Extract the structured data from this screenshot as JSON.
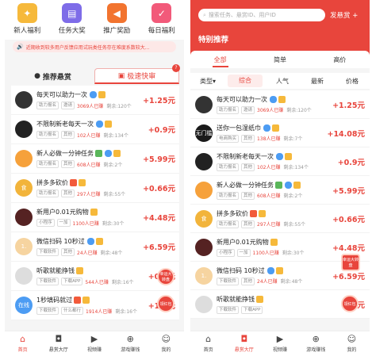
{
  "left": {
    "quick": [
      {
        "label": "新人福利",
        "color": "#f6b93b",
        "icon": "gift-icon",
        "glyph": "✦"
      },
      {
        "label": "任务大奖",
        "color": "#7e6ce8",
        "icon": "clipboard-icon",
        "glyph": "▤"
      },
      {
        "label": "推广奖励",
        "color": "#f2742f",
        "icon": "megaphone-icon",
        "glyph": "◀"
      },
      {
        "label": "每日福利",
        "color": "#f25a7a",
        "icon": "calendar-icon",
        "glyph": "✓"
      }
    ],
    "notice": "近期收到较多用户反馈应用试玩类任务存在难度系数较大...",
    "tabs": {
      "recommend": "推荐悬赏",
      "fast": "极速快审",
      "badge": "?"
    },
    "rows": [
      {
        "title": "每天可以助力一次",
        "tags": [
          "助力报名",
          "邀请"
        ],
        "done": "3069人已赚",
        "left": "剩余:120个",
        "price": "+1.25元",
        "av": "#333",
        "avtext": "",
        "marks": [
          "v",
          "g"
        ]
      },
      {
        "title": "不限制新老每天一次",
        "tags": [
          "助力报名",
          "其他"
        ],
        "done": "102人已赚",
        "left": "剩余:134个",
        "price": "+0.9元",
        "av": "#222",
        "avtext": "",
        "marks": [
          "v",
          "g"
        ]
      },
      {
        "title": "新人必做一分钟任务",
        "tags": [
          "助力报名",
          "其他"
        ],
        "done": "608人已赚",
        "left": "剩余:2个",
        "price": "+5.99元",
        "av": "#f6a13b",
        "avtext": "",
        "marks": [
          "c",
          "v",
          "g"
        ]
      },
      {
        "title": "拼多多砍价",
        "tags": [
          "助力报名",
          "其他"
        ],
        "done": "297人已赚",
        "left": "剩余:55个",
        "price": "+0.66元",
        "av": "#f2b43b",
        "avtext": "食",
        "marks": [
          "h",
          "g"
        ]
      },
      {
        "title": "新用户0.01元购物",
        "tags": [
          "小程序",
          "一加"
        ],
        "done": "1100人已赚",
        "left": "剩余:30个",
        "price": "+4.48元",
        "av": "#552222",
        "avtext": "",
        "marks": [
          "g"
        ]
      },
      {
        "title": "微信扫码 10秒过",
        "tags": [
          "下载软件",
          "其他"
        ],
        "done": "24人已赚",
        "left": "剩余:48个",
        "price": "+6.59元",
        "av": "#f6d4a0",
        "avtext": "1.",
        "marks": [
          "v",
          "g"
        ]
      },
      {
        "title": "听歌就能挣钱",
        "tags": [
          "下载软件",
          "下载APP"
        ],
        "done": "544人已赚",
        "left": "剩余:16个",
        "price": "+0.1元",
        "av": "#dddddd",
        "avtext": "",
        "marks": [
          "g"
        ]
      },
      {
        "title": "1秒填码就过",
        "tags": [
          "下载软件",
          "什么都行"
        ],
        "done": "1914人已赚",
        "left": "剩余:16个",
        "price": "+1.5元",
        "av": "#4c9cf3",
        "avtext": "在线",
        "marks": [
          "h",
          "g"
        ]
      }
    ],
    "floats": [
      {
        "text": "幸运大转盘"
      },
      {
        "text": "领红包"
      }
    ],
    "nav": [
      {
        "label": "首页",
        "icon": "home-icon",
        "glyph": "⌂",
        "active": true
      },
      {
        "label": "悬赏大厅",
        "icon": "gift-box-icon",
        "glyph": "◘",
        "active": false
      },
      {
        "label": "视频赚",
        "icon": "play-icon",
        "glyph": "▶",
        "active": false
      },
      {
        "label": "游戏赚钱",
        "icon": "gamepad-icon",
        "glyph": "⊕",
        "active": false
      },
      {
        "label": "我的",
        "icon": "person-icon",
        "glyph": "☺",
        "active": false
      }
    ]
  },
  "right": {
    "search_placeholder": "搜索任务、悬赏ID、用户ID",
    "post": "发悬赏 +",
    "title": "特别推荐",
    "segments": [
      {
        "label": "全部",
        "active": true
      },
      {
        "label": "简单",
        "active": false
      },
      {
        "label": "高价",
        "active": false
      }
    ],
    "sorter": [
      {
        "label": "类型▾",
        "active": false
      },
      {
        "label": "综合",
        "active": true
      },
      {
        "label": "人气",
        "active": false
      },
      {
        "label": "最新",
        "active": false
      },
      {
        "label": "价格",
        "active": false
      }
    ],
    "rows": [
      {
        "title": "每天可以助力一次",
        "tags": [
          "助力报名",
          "邀请"
        ],
        "done": "3069人已赚",
        "left": "剩余:120个",
        "price": "+1.25元",
        "av": "#333",
        "avtext": "",
        "marks": [
          "v",
          "g"
        ]
      },
      {
        "title": "送你一包湿纸巾",
        "tags": [
          "电商购买",
          "其他"
        ],
        "done": "138人已赚",
        "left": "剩余:7个",
        "price": "+14.08元",
        "av": "#1a1a1a",
        "avtext": "无门槛",
        "marks": [
          "v",
          "g"
        ]
      },
      {
        "title": "不限制新老每天一次",
        "tags": [
          "助力报名",
          "其他"
        ],
        "done": "102人已赚",
        "left": "剩余:134个",
        "price": "+0.9元",
        "av": "#222",
        "avtext": "",
        "marks": [
          "v",
          "g"
        ]
      },
      {
        "title": "新人必做一分钟任务",
        "tags": [
          "助力报名",
          "其他"
        ],
        "done": "608人已赚",
        "left": "剩余:2个",
        "price": "+5.99元",
        "av": "#f6a13b",
        "avtext": "",
        "marks": [
          "c",
          "v",
          "g"
        ]
      },
      {
        "title": "拼多多砍价",
        "tags": [
          "助力报名",
          "其他"
        ],
        "done": "297人已赚",
        "left": "剩余:55个",
        "price": "+0.66元",
        "av": "#f2b43b",
        "avtext": "食",
        "marks": [
          "h",
          "g"
        ]
      },
      {
        "title": "新用户0.01元购物",
        "tags": [
          "小程序",
          "一加"
        ],
        "done": "1100人已赚",
        "left": "剩余:30个",
        "price": "+4.48元",
        "av": "#552222",
        "avtext": "",
        "marks": [
          "g"
        ]
      },
      {
        "title": "微信扫码 10秒过",
        "tags": [
          "下载软件",
          "其他"
        ],
        "done": "24人已赚",
        "left": "剩余:48个",
        "price": "+6.59元",
        "av": "#f6d4a0",
        "avtext": "1.",
        "marks": [
          "v",
          "g"
        ]
      },
      {
        "title": "听歌就能挣钱",
        "tags": [
          "下载软件",
          "下载APP"
        ],
        "done": "",
        "left": "",
        "price": "+3元",
        "av": "#dddddd",
        "avtext": "",
        "marks": [
          "g"
        ]
      }
    ],
    "floats": [
      {
        "text": "幸运大转盘"
      },
      {
        "text": "领红包"
      }
    ],
    "nav": [
      {
        "label": "首页",
        "icon": "home-icon",
        "glyph": "⌂",
        "active": false
      },
      {
        "label": "悬赏大厅",
        "icon": "gift-box-icon",
        "glyph": "◘",
        "active": true
      },
      {
        "label": "视频赚",
        "icon": "play-icon",
        "glyph": "▶",
        "active": false
      },
      {
        "label": "游戏赚钱",
        "icon": "gamepad-icon",
        "glyph": "⊕",
        "active": false
      },
      {
        "label": "我的",
        "icon": "person-icon",
        "glyph": "☺",
        "active": false
      }
    ]
  }
}
